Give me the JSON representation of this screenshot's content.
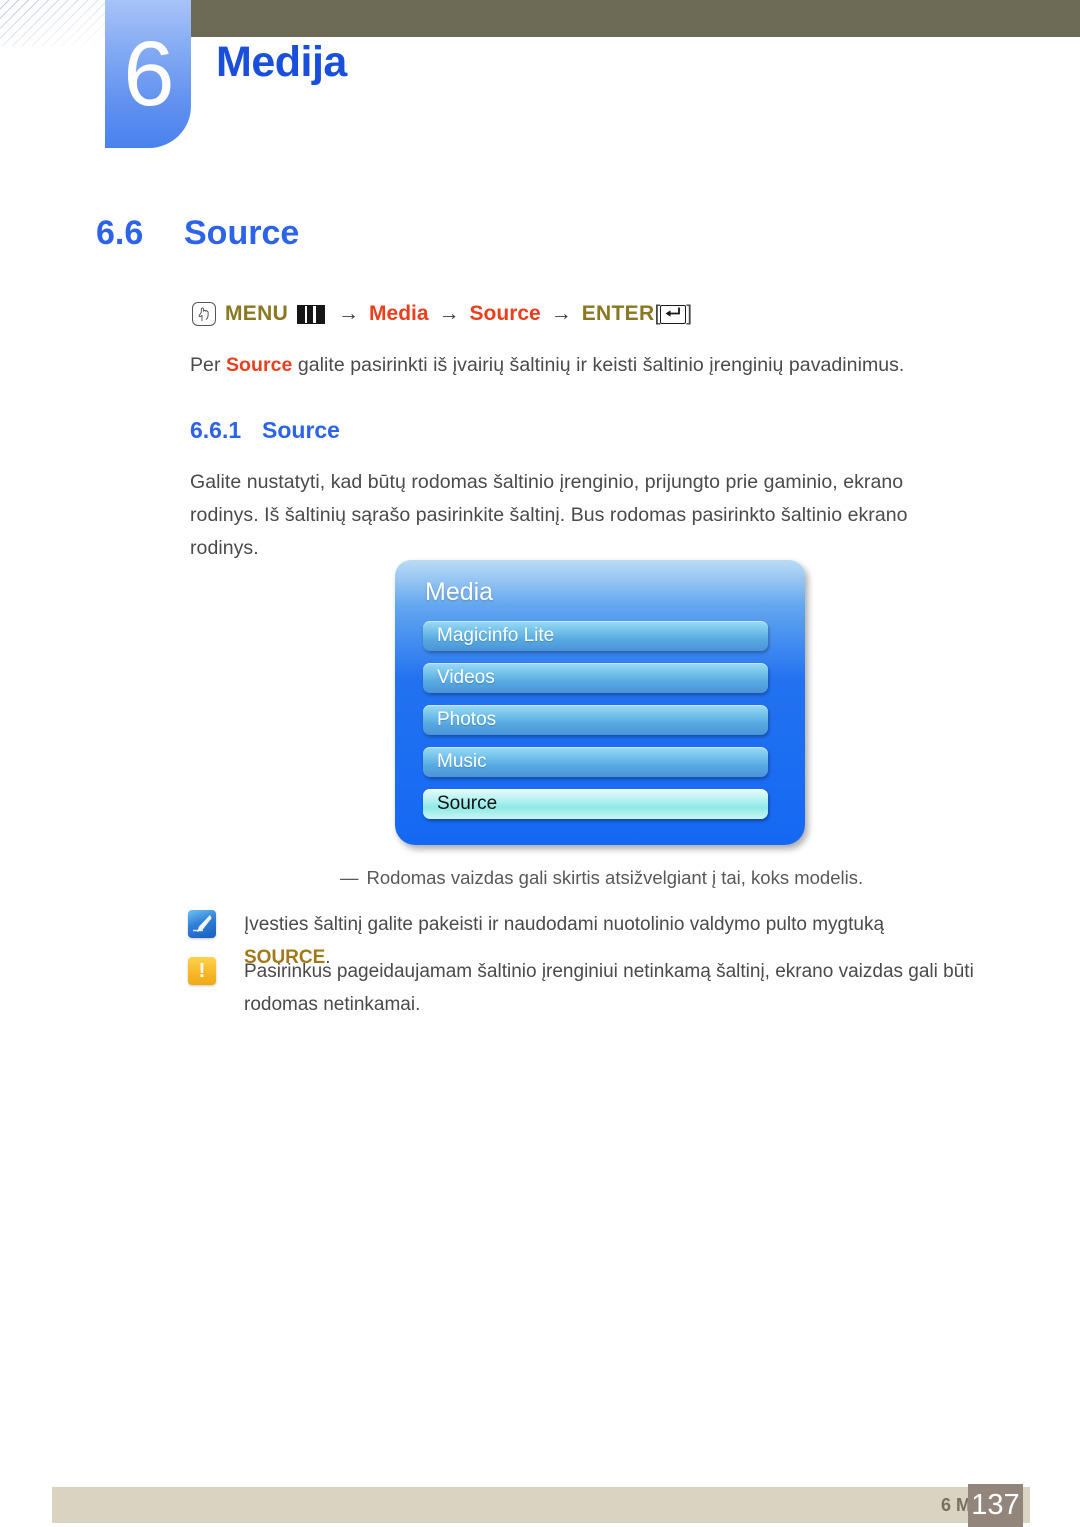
{
  "header": {
    "chapter_number": "6",
    "chapter_title": "Medija",
    "accent_blue": "#1a4fdc",
    "tab_blue": "#5f90ef",
    "bar_olive": "#6d6a55"
  },
  "section": {
    "number": "6.6",
    "title": "Source"
  },
  "menu_path": {
    "hand_icon": "hand-pointer-icon",
    "menu_label": "MENU",
    "grid_icon": "menu-grid-icon",
    "arrow": "→",
    "step_media": "Media",
    "step_source": "Source",
    "enter_label": "ENTER",
    "bracket_open": "[",
    "bracket_close": "]",
    "enter_icon": "enter-key-icon"
  },
  "intro": {
    "prefix": "Per ",
    "bold": "Source",
    "suffix": " galite pasirinkti iš įvairių šaltinių ir keisti šaltinio įrenginių pavadinimus."
  },
  "subsection": {
    "number": "6.6.1",
    "title": "Source"
  },
  "description": "Galite nustatyti, kad būtų rodomas šaltinio įrenginio, prijungto prie gaminio, ekrano rodinys. Iš šaltinių sąrašo pasirinkite šaltinį. Bus rodomas pasirinkto šaltinio ekrano rodinys.",
  "osd": {
    "title": "Media",
    "items": [
      {
        "label": "Magicinfo Lite",
        "selected": false
      },
      {
        "label": "Videos",
        "selected": false
      },
      {
        "label": "Photos",
        "selected": false
      },
      {
        "label": "Music",
        "selected": false
      },
      {
        "label": "Source",
        "selected": true
      }
    ],
    "caption_dash": "―",
    "caption": "Rodomas vaizdas gali skirtis atsižvelgiant į tai, koks modelis."
  },
  "notes": [
    {
      "icon": "note-pen-icon",
      "prefix": "Įvesties šaltinį galite pakeisti ir naudodami nuotolinio valdymo pulto mygtuką ",
      "bold": "SOURCE",
      "suffix": "."
    },
    {
      "icon": "warning-exclamation-icon",
      "mark": "!",
      "text": "Pasirinkus pageidaujamam šaltinio įrenginiui netinkamą šaltinį, ekrano vaizdas gali būti rodomas netinkamai."
    }
  ],
  "footer": {
    "label": "6 Medija",
    "page": "137"
  }
}
